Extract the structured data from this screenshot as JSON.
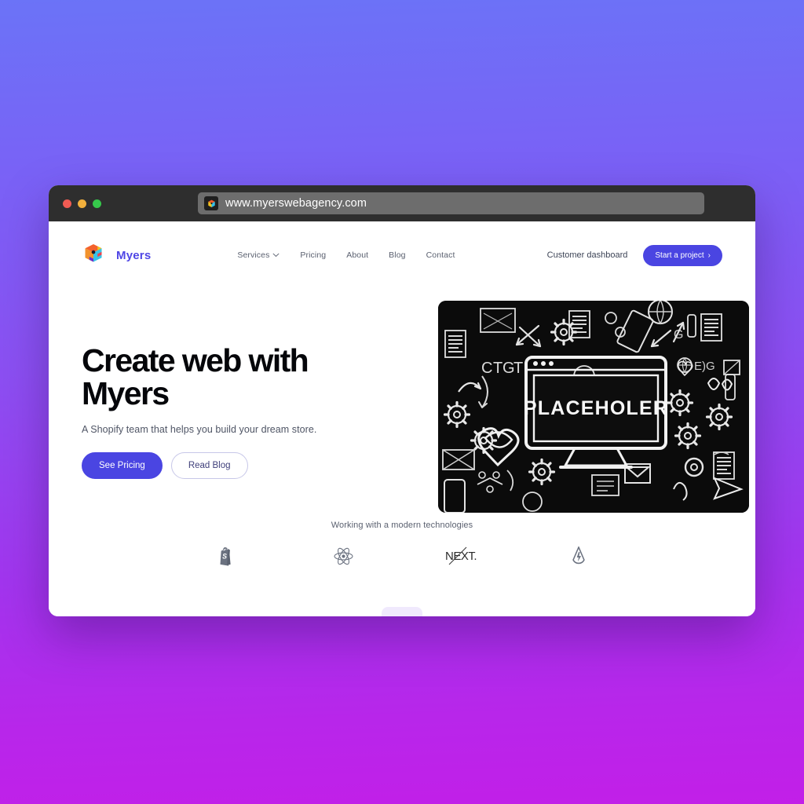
{
  "browser": {
    "traffic_lights": [
      "close-red",
      "minimize-yellow",
      "maximize-green"
    ],
    "url": "www.myerswebagency.com",
    "favicon_name": "cube-favicon",
    "colors": {
      "chrome_bg": "#2e2e2e",
      "url_field_bg": "#6d6d6d",
      "red": "#f05b53",
      "yellow": "#f2b03c",
      "green": "#36c84b"
    }
  },
  "page_background": {
    "gradient_from": "#6b73f7",
    "gradient_to": "#c21fe8"
  },
  "site": {
    "brand": {
      "name": "Myers",
      "logo_name": "isometric-cube-logo",
      "color": "#4f46e5"
    },
    "nav": {
      "links": [
        {
          "label": "Services",
          "has_dropdown": true,
          "chevron": "⌄"
        },
        {
          "label": "Pricing",
          "has_dropdown": false
        },
        {
          "label": "About",
          "has_dropdown": false
        },
        {
          "label": "Blog",
          "has_dropdown": false
        },
        {
          "label": "Contact",
          "has_dropdown": false
        }
      ],
      "dashboard_link": "Customer dashboard",
      "cta": {
        "label": "Start a project",
        "arrow": "›",
        "color": "#4a45e2"
      }
    },
    "hero": {
      "title_line_1": "Create web with",
      "title_line_2": "Myers",
      "subtitle": "A Shopify team that helps you build your dream store.",
      "primary_button": "See Pricing",
      "secondary_button": "Read Blog",
      "image": {
        "name": "chalkboard-doodle-hero-image",
        "screen_text": "PLACEHOLER",
        "background": "#0a0a0a",
        "stroke": "#ffffff"
      }
    },
    "tech": {
      "caption": "Working with a modern technologies",
      "logos": [
        {
          "name": "shopify-logo",
          "label": "Shopify"
        },
        {
          "name": "react-logo",
          "label": "React"
        },
        {
          "name": "nextjs-logo",
          "label": "NEXT."
        },
        {
          "name": "astro-logo",
          "label": "Astro"
        }
      ]
    }
  }
}
